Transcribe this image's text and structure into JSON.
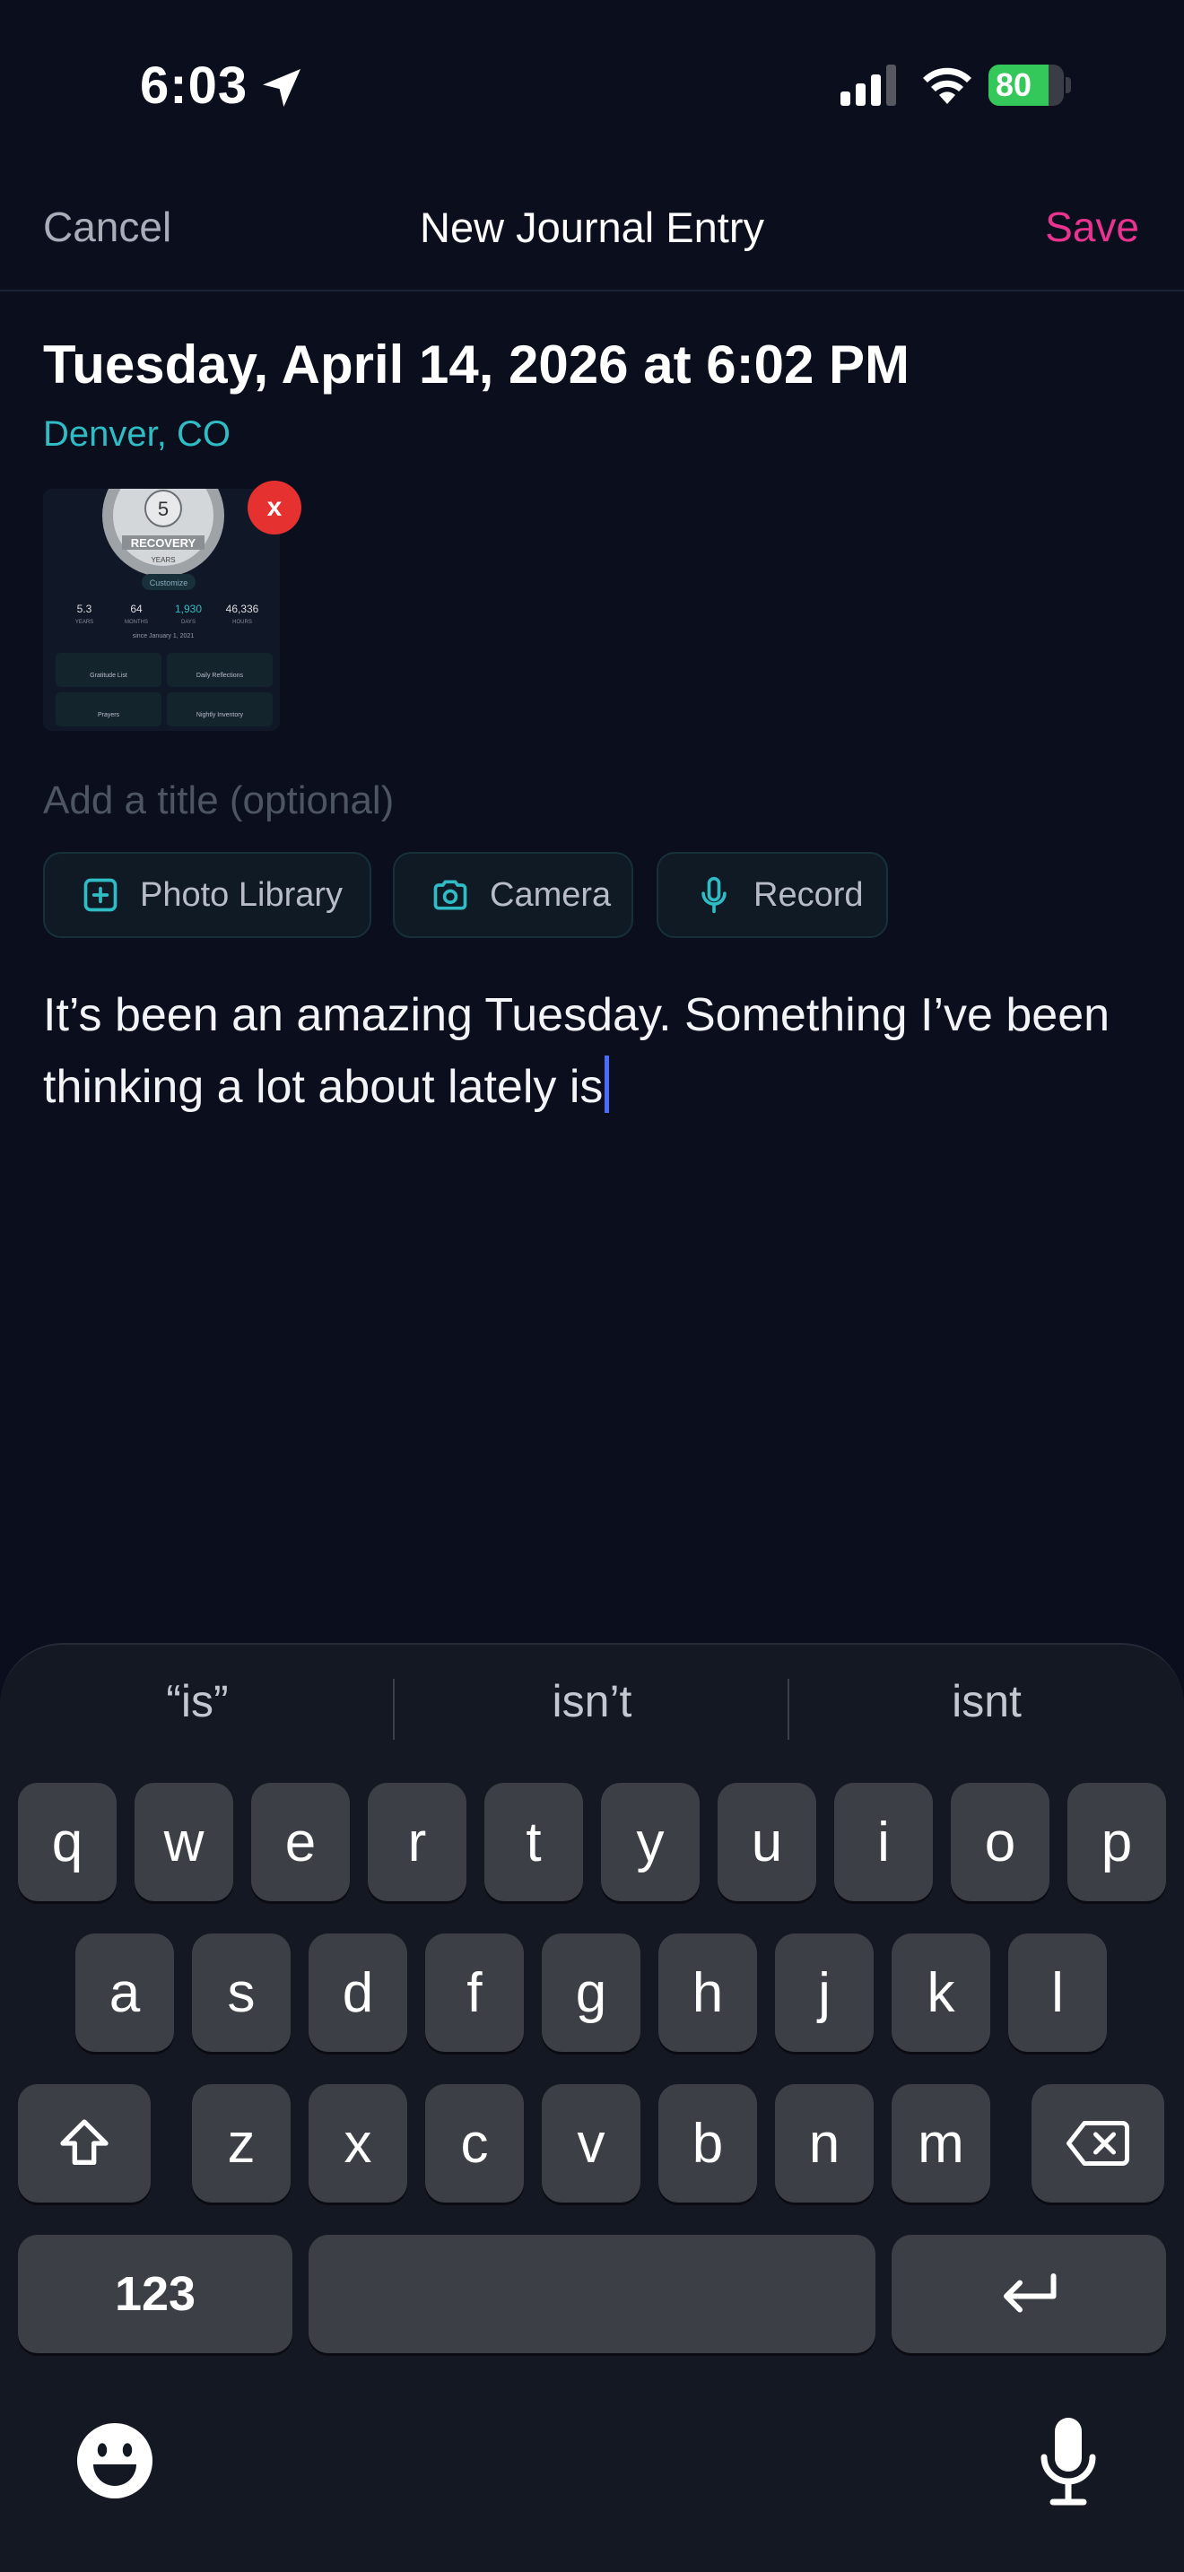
{
  "status_bar": {
    "time": "6:03",
    "battery": "80",
    "battery_level": 0.8
  },
  "nav": {
    "cancel_label": "Cancel",
    "title": "New Journal Entry",
    "save_label": "Save"
  },
  "entry": {
    "date": "Tuesday, April 14, 2026 at 6:02 PM",
    "location": "Denver, CO",
    "title_placeholder": "Add a title (optional)",
    "body": "It’s been an amazing Tuesday. Something I’ve been thinking a lot about lately is"
  },
  "attachment": {
    "remove_label": "x",
    "screenshot": {
      "badge_number": "5",
      "badge_text": "RECOVERY",
      "badge_subtext": "YEARS",
      "customize_label": "Customize",
      "stats": [
        {
          "value": "5.3",
          "label": "YEARS"
        },
        {
          "value": "64",
          "label": "MONTHS"
        },
        {
          "value": "1,930",
          "label": "DAYS"
        },
        {
          "value": "46,336",
          "label": "HOURS"
        }
      ],
      "since": "since January 1, 2021",
      "tiles": [
        "Gratitude List",
        "Daily Reflections",
        "Prayers",
        "Nightly Inventory"
      ]
    }
  },
  "media_buttons": {
    "photo_library": "Photo Library",
    "camera": "Camera",
    "record": "Record"
  },
  "keyboard": {
    "suggestions": [
      "“is”",
      "isn’t",
      "isnt"
    ],
    "row1": [
      "q",
      "w",
      "e",
      "r",
      "t",
      "y",
      "u",
      "i",
      "o",
      "p"
    ],
    "row2": [
      "a",
      "s",
      "d",
      "f",
      "g",
      "h",
      "j",
      "k",
      "l"
    ],
    "row3": [
      "z",
      "x",
      "c",
      "v",
      "b",
      "n",
      "m"
    ],
    "numbers_label": "123"
  },
  "colors": {
    "accent_save": "#e8338f",
    "location": "#2fbcc4",
    "background": "#0b0e1c",
    "caret": "#4a6cf7"
  }
}
